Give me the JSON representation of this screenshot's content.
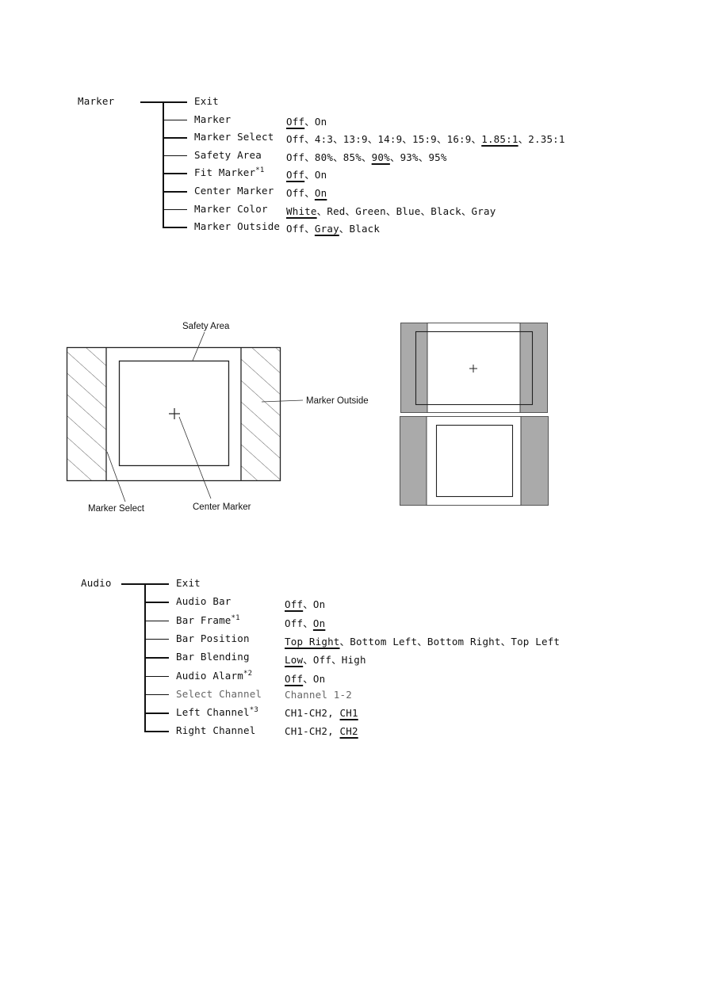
{
  "marker_menu": {
    "root_label": "Marker",
    "items": [
      {
        "label": "Exit",
        "superscript": "",
        "options": []
      },
      {
        "label": "Marker",
        "superscript": "",
        "options": [
          {
            "text": "Off",
            "default": true
          },
          {
            "text": "On",
            "default": false
          }
        ]
      },
      {
        "label": "Marker Select",
        "superscript": "",
        "options": [
          {
            "text": "Off",
            "default": false
          },
          {
            "text": "4:3",
            "default": false
          },
          {
            "text": "13:9",
            "default": false
          },
          {
            "text": "14:9",
            "default": false
          },
          {
            "text": "15:9",
            "default": false
          },
          {
            "text": "16:9",
            "default": false
          },
          {
            "text": "1.85:1",
            "default": true
          },
          {
            "text": "2.35:1",
            "default": false
          }
        ]
      },
      {
        "label": "Safety Area",
        "superscript": "",
        "options": [
          {
            "text": "Off",
            "default": false
          },
          {
            "text": "80%",
            "default": false
          },
          {
            "text": "85%",
            "default": false
          },
          {
            "text": "90%",
            "default": true
          },
          {
            "text": "93%",
            "default": false
          },
          {
            "text": "95%",
            "default": false
          }
        ]
      },
      {
        "label": "Fit Marker",
        "superscript": "*1",
        "options": [
          {
            "text": "Off",
            "default": true
          },
          {
            "text": "On",
            "default": false
          }
        ]
      },
      {
        "label": "Center Marker",
        "superscript": "",
        "options": [
          {
            "text": "Off",
            "default": false
          },
          {
            "text": "On",
            "default": true
          }
        ]
      },
      {
        "label": "Marker Color",
        "superscript": "",
        "options": [
          {
            "text": "White",
            "default": true
          },
          {
            "text": "Red",
            "default": false
          },
          {
            "text": "Green",
            "default": false
          },
          {
            "text": "Blue",
            "default": false
          },
          {
            "text": "Black",
            "default": false
          },
          {
            "text": "Gray",
            "default": false
          }
        ]
      },
      {
        "label": "Marker Outside",
        "superscript": "",
        "options": [
          {
            "text": "Off",
            "default": false
          },
          {
            "text": "Gray",
            "default": true
          },
          {
            "text": "Black",
            "default": false
          }
        ]
      }
    ],
    "separator": "、"
  },
  "diagram": {
    "labels": {
      "safety_area": "Safety Area",
      "marker_outside": "Marker Outside",
      "marker_select": "Marker Select",
      "center_marker": "Center Marker"
    },
    "fill_color": "#aaaaaa"
  },
  "audio_menu": {
    "root_label": "Audio",
    "items": [
      {
        "label": "Exit",
        "superscript": "",
        "disabled": false,
        "options": []
      },
      {
        "label": "Audio Bar",
        "superscript": "",
        "disabled": false,
        "sep": "、",
        "options": [
          {
            "text": "Off",
            "default": true
          },
          {
            "text": "On",
            "default": false
          }
        ]
      },
      {
        "label": "Bar Frame",
        "superscript": "*1",
        "disabled": false,
        "sep": "、",
        "options": [
          {
            "text": "Off",
            "default": false
          },
          {
            "text": "On",
            "default": true
          }
        ]
      },
      {
        "label": "Bar Position",
        "superscript": "",
        "disabled": false,
        "sep": "、",
        "options": [
          {
            "text": "Top Right",
            "default": true
          },
          {
            "text": "Bottom Left",
            "default": false
          },
          {
            "text": "Bottom Right",
            "default": false
          },
          {
            "text": "Top Left",
            "default": false
          }
        ]
      },
      {
        "label": "Bar Blending",
        "superscript": "",
        "disabled": false,
        "sep": "、",
        "options": [
          {
            "text": "Low",
            "default": true
          },
          {
            "text": "Off",
            "default": false
          },
          {
            "text": "High",
            "default": false
          }
        ]
      },
      {
        "label": "Audio Alarm",
        "superscript": "*2",
        "disabled": false,
        "sep": "、",
        "options": [
          {
            "text": "Off",
            "default": true
          },
          {
            "text": "On",
            "default": false
          }
        ]
      },
      {
        "label": "Select Channel",
        "superscript": "",
        "disabled": true,
        "sep": "",
        "options": [
          {
            "text": "Channel 1-2",
            "default": false
          }
        ]
      },
      {
        "label": "Left Channel",
        "superscript": "*3",
        "disabled": false,
        "sep": ", ",
        "options": [
          {
            "text": "CH1-CH2",
            "default": false
          },
          {
            "text": "CH1",
            "default": true
          }
        ]
      },
      {
        "label": "Right Channel",
        "superscript": "",
        "disabled": false,
        "sep": ", ",
        "options": [
          {
            "text": "CH1-CH2",
            "default": false
          },
          {
            "text": "CH2",
            "default": true
          }
        ]
      }
    ]
  }
}
